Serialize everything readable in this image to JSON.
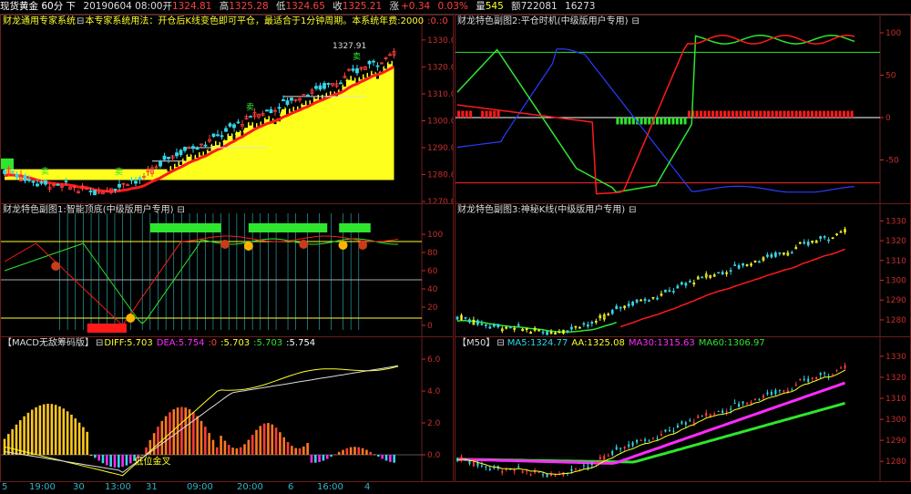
{
  "header": {
    "instrument": "现货黄金 60分 下",
    "date": "20190604 08:00",
    "open_label": "开",
    "open": "1324.81",
    "high_label": "高",
    "high": "1325.28",
    "low_label": "低",
    "low": "1324.65",
    "close_label": "收",
    "close": "1325.21",
    "change_label": "涨",
    "change": "+0.34",
    "change_pct": "0.03%",
    "volume_label": "量",
    "volume": "545",
    "amount_label": "额",
    "amount": "722081",
    "open_interest": "16273"
  },
  "panels": {
    "main": {
      "title": "财龙通用专家系统",
      "toggle": "⊟",
      "desc": "本专家系统用法：开仓后K线变色即可平仓，最适合于1分钟周期。本系统年费:2000",
      "extra": ":0.:0",
      "price_label": "1327.91",
      "sell_markers": [
        "卖",
        "卖",
        "卖",
        "卖"
      ],
      "y_ticks": [
        "1330.0",
        "1320.0",
        "1310.0",
        "1300.0",
        "1290.0",
        "1280.0",
        "1270.0"
      ]
    },
    "sub1": {
      "title": "财龙特色副图1:智能顶底(中级版用户专用)",
      "toggle": "⊟",
      "y_ticks": [
        "100",
        "80",
        "60",
        "40",
        "20",
        "0"
      ]
    },
    "sub2": {
      "title": "财龙特色副图2:平仓时机(中级版用户专用)",
      "toggle": "⊟",
      "y_ticks": [
        "100",
        "50",
        "0",
        "-50"
      ]
    },
    "sub3": {
      "title": "财龙特色副图3:神秘K线(中级版用户专用)",
      "toggle": "⊟",
      "y_ticks": [
        "1330",
        "1320",
        "1310",
        "1300",
        "1290",
        "1280"
      ]
    },
    "macd": {
      "title": "【MACD无敌筹码版】",
      "toggle": "⊟",
      "diff": "DIFF:5.703",
      "dea": "DEA:5.754",
      "v0": ":0",
      "v1": ":5.703",
      "v2": ":5.703",
      "v3": ":5.754",
      "annotation": "低位金叉",
      "y_ticks": [
        "6.0",
        "4.0",
        "2.0",
        "0.0"
      ]
    },
    "m50": {
      "title": "【M50】",
      "toggle": "⊟",
      "ma5": "MA5:1324.77",
      "aa": "AA:1325.08",
      "ma30": "MA30:1315.63",
      "ma60": "MA60:1306.97",
      "y_ticks": [
        "1330",
        "1320",
        "1310",
        "1300",
        "1290",
        "1280"
      ]
    }
  },
  "x_axis": [
    "5",
    "19:00",
    "30",
    "13:00",
    "31",
    "09:00",
    "20:00",
    "6",
    "16:00",
    "4"
  ],
  "colors": {
    "frame": "#6b1d1d",
    "axis": "#c82d2d",
    "up": "#ff3c3c",
    "down": "#35d7e8",
    "yellow": "#ffff2a",
    "green": "#2ee62e",
    "magenta": "#ff2bff",
    "blue": "#2a3cff"
  }
}
